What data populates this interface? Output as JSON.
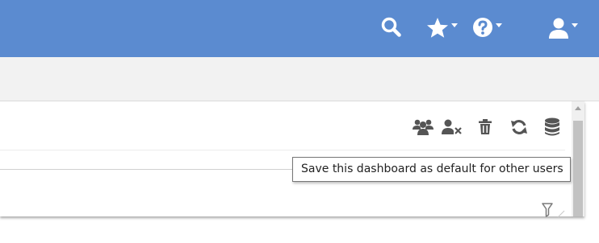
{
  "colors": {
    "header_bg": "#5b8bd0",
    "header_icon": "#ffffff",
    "toolbar_icon": "#555555",
    "subbar_bg": "#f2f2f2"
  },
  "header": {
    "icons": [
      "search-icon",
      "star-icon",
      "help-icon",
      "user-icon"
    ]
  },
  "panel": {
    "toolbar_icons": [
      "users-group-icon",
      "remove-user-icon",
      "trash-icon",
      "refresh-icon",
      "database-icon"
    ],
    "filter_icon": "filter-icon"
  },
  "tooltip": {
    "text": "Save this dashboard as default for other users"
  }
}
